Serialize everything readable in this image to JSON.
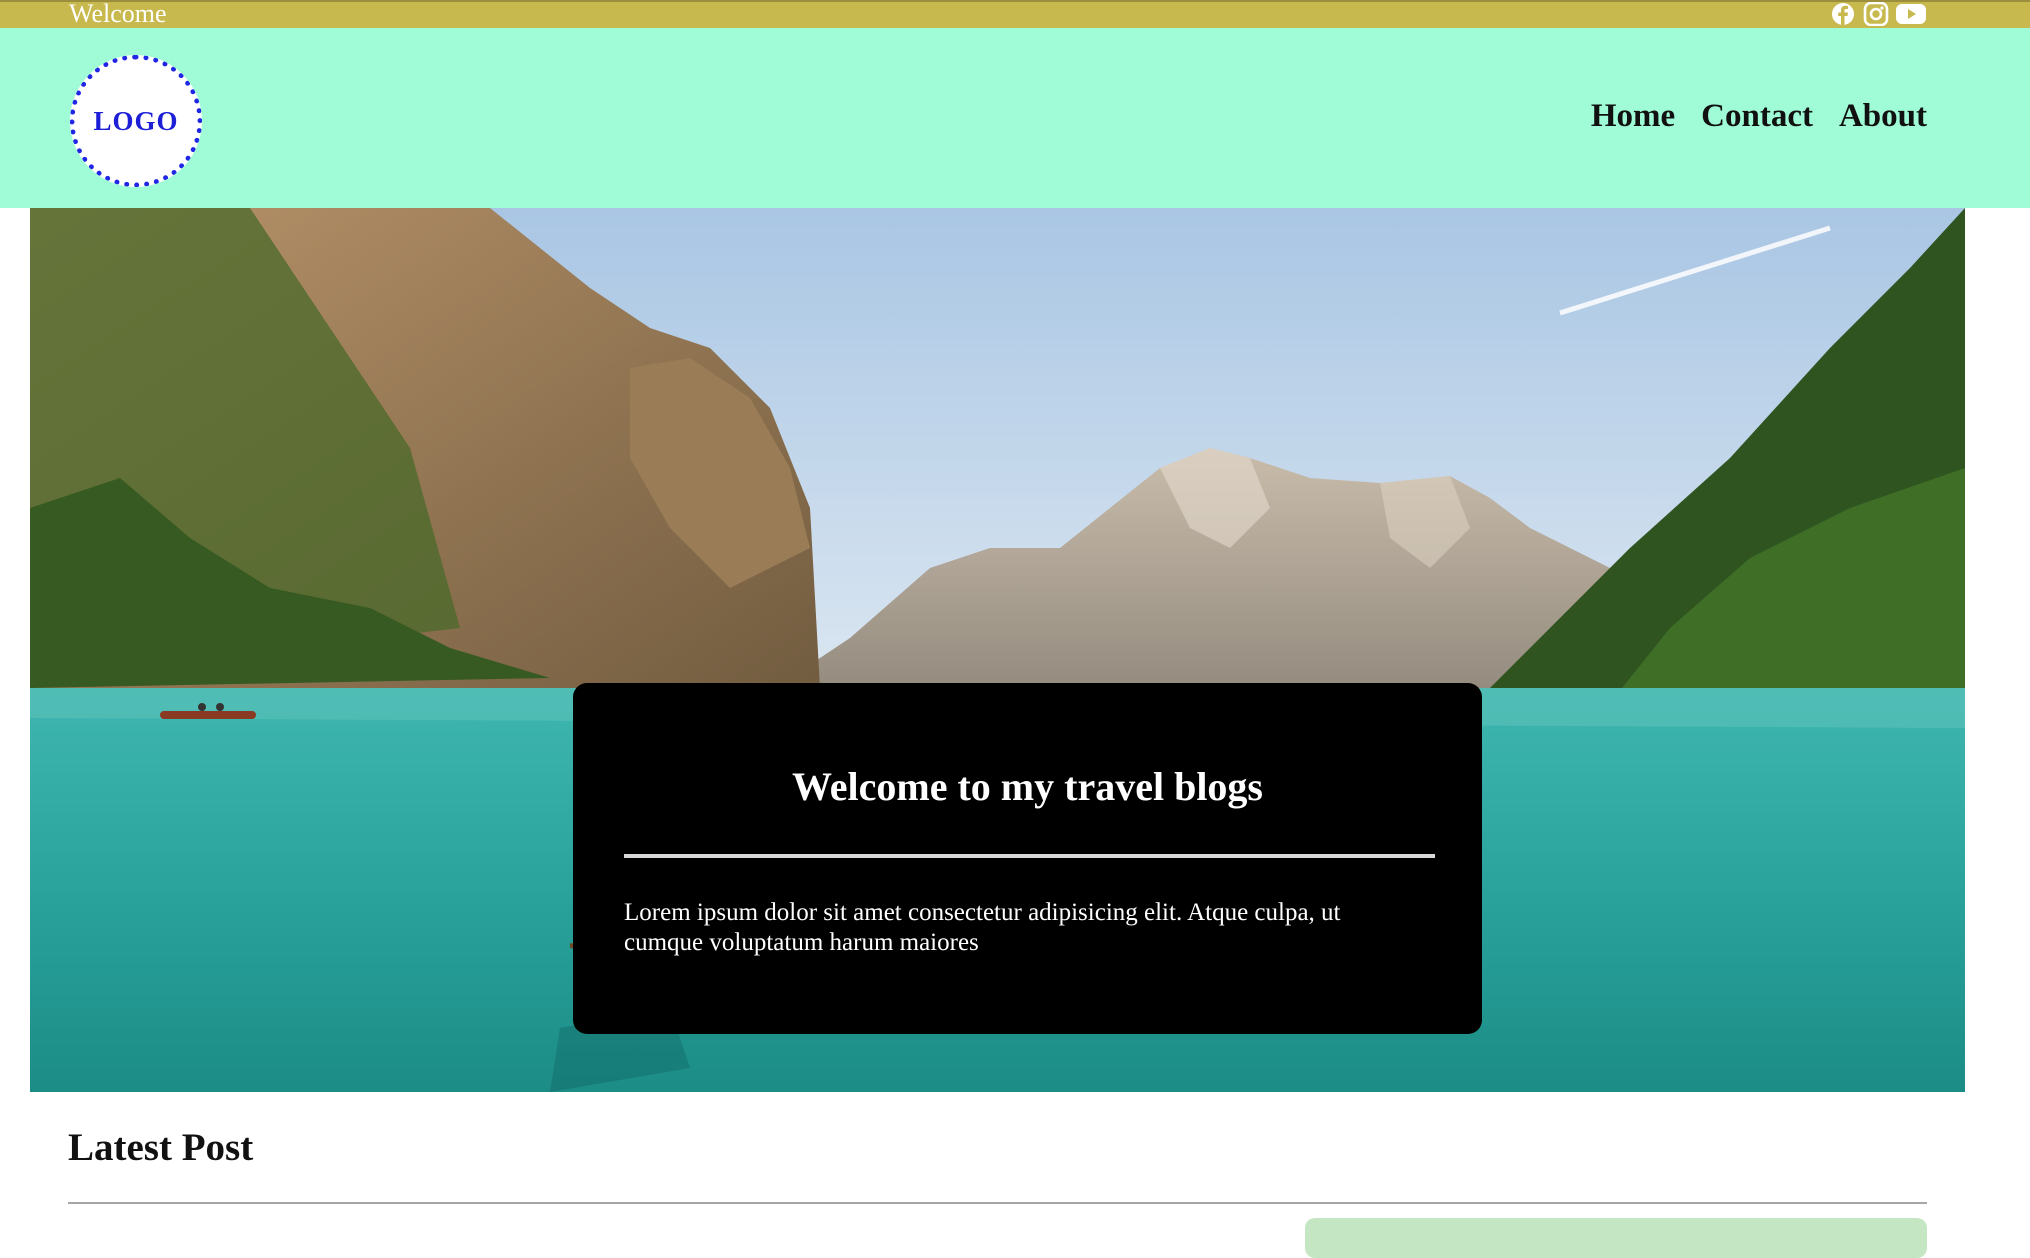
{
  "topbar": {
    "welcome": "Welcome",
    "social_icons": [
      "facebook-icon",
      "instagram-icon",
      "youtube-icon"
    ],
    "color": "#c8b94f"
  },
  "header": {
    "logo_text": "LOGO",
    "nav": [
      {
        "label": "Home"
      },
      {
        "label": "Contact"
      },
      {
        "label": "About"
      }
    ],
    "background": "#9ffcd6"
  },
  "hero": {
    "image": "mountain-lake-rowboat-photo",
    "title": "Welcome to my travel blogs",
    "text": "Lorem ipsum dolor sit amet consectetur adipisicing elit. Atque culpa, ut cumque voluptatum harum maiores"
  },
  "latest": {
    "heading": "Latest Post"
  }
}
